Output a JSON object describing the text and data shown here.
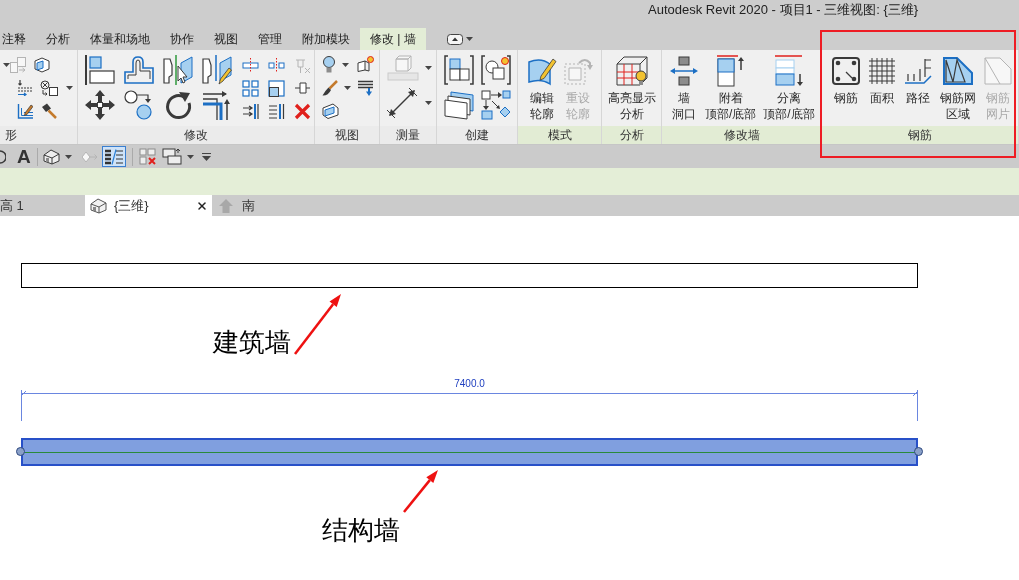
{
  "window": {
    "title": "Autodesk Revit 2020 - 项目1 - 三维视图: {三维}"
  },
  "ribbon_tabs": [
    {
      "label": "注释",
      "selected": false
    },
    {
      "label": "分析",
      "selected": false
    },
    {
      "label": "体量和场地",
      "selected": false
    },
    {
      "label": "协作",
      "selected": false
    },
    {
      "label": "视图",
      "selected": false
    },
    {
      "label": "管理",
      "selected": false
    },
    {
      "label": "附加模块",
      "selected": false
    },
    {
      "label": "修改 | 墙",
      "selected": true
    }
  ],
  "ribbon_panels": [
    {
      "kind": "tools",
      "label": "形",
      "contextual": false,
      "highlighted": false,
      "tools": [
        {
          "disabled": true
        },
        {
          "disabled": false
        },
        {
          "disabled": false
        },
        {
          "disabled": false
        },
        {
          "disabled": false
        },
        {
          "disabled": false
        }
      ]
    },
    {
      "kind": "tools",
      "label": "修改",
      "contextual": false,
      "highlighted": false,
      "tools": [
        {
          "disabled": false
        },
        {
          "disabled": false
        },
        {
          "disabled": false
        },
        {
          "disabled": false
        },
        {
          "disabled": false
        },
        {
          "disabled": false
        },
        {
          "disabled": false
        },
        {
          "disabled": false
        },
        {
          "disabled": false
        },
        {
          "disabled": false
        },
        {
          "disabled": true
        },
        {
          "disabled": false
        },
        {
          "disabled": false
        },
        {
          "disabled": false
        },
        {
          "disabled": false
        },
        {
          "disabled": false
        },
        {
          "disabled": false
        }
      ]
    },
    {
      "kind": "tools",
      "label": "视图",
      "contextual": false,
      "highlighted": false,
      "tools": [
        {
          "disabled": false
        },
        {
          "disabled": false
        },
        {
          "disabled": false
        },
        {
          "disabled": false
        },
        {
          "disabled": false
        }
      ]
    },
    {
      "kind": "tools",
      "label": "测量",
      "contextual": false,
      "highlighted": false,
      "tools": [
        {
          "disabled": true
        },
        {
          "disabled": false
        }
      ]
    },
    {
      "kind": "tools",
      "label": "创建",
      "contextual": false,
      "highlighted": false,
      "tools": [
        {
          "disabled": false
        },
        {
          "disabled": false
        },
        {
          "disabled": false
        },
        {
          "disabled": false
        }
      ]
    },
    {
      "kind": "buttons",
      "label": "模式",
      "contextual": true,
      "highlighted": false,
      "buttons": [
        {
          "lines": [
            "编辑",
            "轮廓"
          ],
          "disabled": false
        },
        {
          "lines": [
            "重设",
            "轮廓"
          ],
          "disabled": true
        }
      ]
    },
    {
      "kind": "buttons",
      "label": "分析",
      "contextual": true,
      "highlighted": false,
      "buttons": [
        {
          "lines": [
            "高亮显示",
            "分析"
          ],
          "disabled": false
        }
      ]
    },
    {
      "kind": "buttons",
      "label": "修改墙",
      "contextual": true,
      "highlighted": false,
      "buttons": [
        {
          "lines": [
            "墙",
            "洞口"
          ],
          "disabled": false
        },
        {
          "lines": [
            "附着",
            "顶部/底部"
          ],
          "disabled": false
        },
        {
          "lines": [
            "分离",
            "顶部/底部"
          ],
          "disabled": false
        }
      ]
    },
    {
      "kind": "buttons",
      "label": "钢筋",
      "contextual": true,
      "highlighted": true,
      "buttons": [
        {
          "lines": [
            "钢筋"
          ],
          "disabled": false
        },
        {
          "lines": [
            "面积"
          ],
          "disabled": false
        },
        {
          "lines": [
            "路径"
          ],
          "disabled": false
        },
        {
          "lines": [
            "钢筋网",
            "区域"
          ],
          "disabled": false
        },
        {
          "lines": [
            "钢筋",
            "网片"
          ],
          "disabled": true
        }
      ]
    }
  ],
  "quick_access": [
    {
      "kind": "button",
      "disabled": false
    },
    {
      "kind": "glyph",
      "text": "A"
    },
    {
      "kind": "split",
      "disabled": false
    },
    {
      "kind": "button",
      "disabled": true
    },
    {
      "kind": "toggle",
      "on": true
    },
    {
      "kind": "button",
      "disabled": false
    },
    {
      "kind": "split",
      "disabled": false
    },
    {
      "kind": "menu"
    }
  ],
  "view_tabs": [
    {
      "label": "高 1",
      "selected": false
    },
    {
      "kind": "perspective",
      "label": "{三维}",
      "selected": true
    },
    {
      "kind": "elevation",
      "label": "南",
      "selected": false
    }
  ],
  "canvas": {
    "walls": [
      {
        "selected": false,
        "callout": "建筑墙"
      },
      {
        "selected": true,
        "dimension": "7400.0",
        "callout": "结构墙"
      }
    ]
  }
}
